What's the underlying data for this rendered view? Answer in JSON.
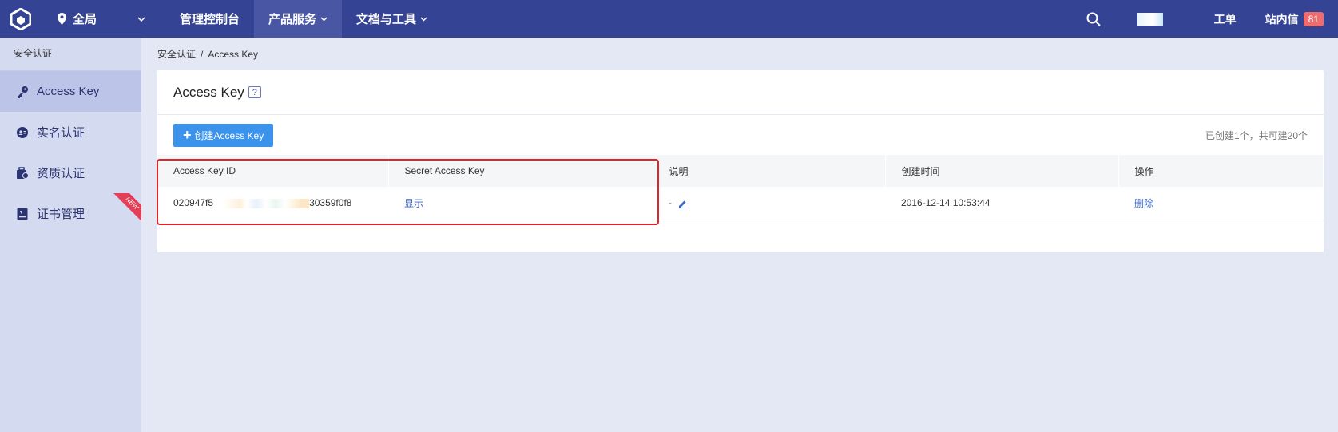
{
  "topbar": {
    "region": "全局",
    "nav": [
      {
        "label": "管理控制台"
      },
      {
        "label": "产品服务"
      },
      {
        "label": "文档与工具"
      }
    ],
    "ticket": "工单",
    "messages": "站内信",
    "message_count": "81"
  },
  "sidebar": {
    "header": "安全认证",
    "items": [
      {
        "label": "Access Key",
        "icon": "key-icon"
      },
      {
        "label": "实名认证",
        "icon": "id-card-icon"
      },
      {
        "label": "资质认证",
        "icon": "briefcase-icon"
      },
      {
        "label": "证书管理",
        "icon": "certificate-icon",
        "badge": "NEW"
      }
    ]
  },
  "breadcrumb": {
    "parent": "安全认证",
    "separator": "/",
    "current": "Access Key"
  },
  "panel": {
    "title": "Access Key",
    "help": "?",
    "create_button": "创建Access Key",
    "quota": "已创建1个，共可建20个",
    "columns": [
      "Access Key ID",
      "Secret Access Key",
      "说明",
      "创建时间",
      "操作"
    ],
    "rows": [
      {
        "id_prefix": "020947f5",
        "id_suffix": "30359f0f8",
        "secret_action": "显示",
        "description": "-",
        "created": "2016-12-14 10:53:44",
        "action": "删除"
      }
    ]
  },
  "colors": {
    "topbar": "#354394",
    "accent_button": "#3b93ec",
    "highlight": "#e1232b"
  }
}
